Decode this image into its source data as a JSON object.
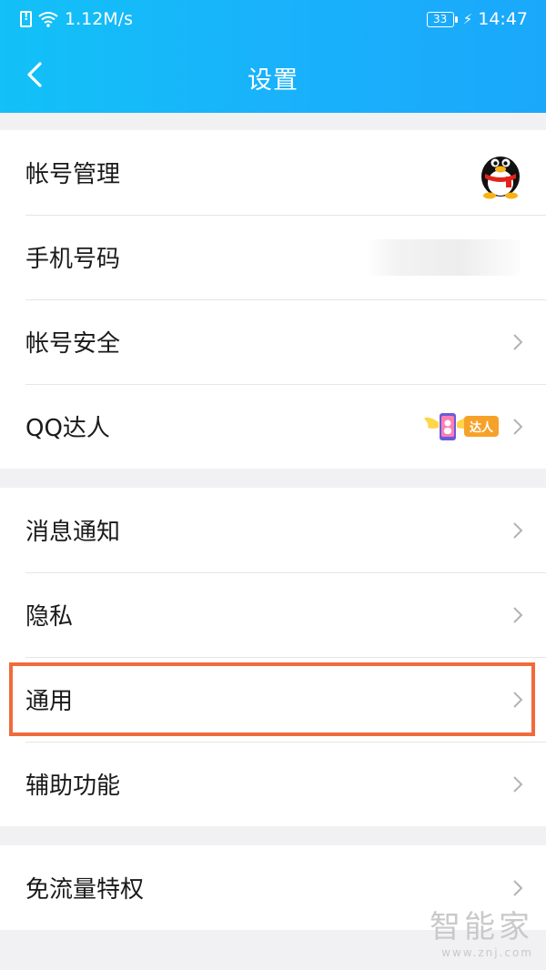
{
  "status_bar": {
    "network_speed": "1.12M/s",
    "battery_level": "33",
    "time": "14:47",
    "icons": [
      "sim-alert-icon",
      "wifi-icon",
      "battery-icon",
      "charging-bolt-icon"
    ]
  },
  "header": {
    "title": "设置",
    "back_icon": "back-arrow-icon"
  },
  "groups": [
    {
      "items": [
        {
          "label": "帐号管理",
          "accessory": "qq-penguin-avatar"
        },
        {
          "label": "手机号码",
          "accessory": "blurred-phone-number"
        },
        {
          "label": "帐号安全",
          "accessory": "chevron"
        },
        {
          "label": "QQ达人",
          "accessory": "badge+chevron",
          "badge_text": "达人"
        }
      ]
    },
    {
      "items": [
        {
          "label": "消息通知",
          "accessory": "chevron"
        },
        {
          "label": "隐私",
          "accessory": "chevron"
        },
        {
          "label": "通用",
          "accessory": "chevron",
          "highlighted": true
        },
        {
          "label": "辅助功能",
          "accessory": "chevron"
        }
      ]
    },
    {
      "items": [
        {
          "label": "免流量特权",
          "accessory": "chevron"
        }
      ]
    }
  ],
  "watermark": {
    "text": "智能家",
    "url": "www.znj.com"
  },
  "colors": {
    "header_gradient_start": "#12c1f7",
    "header_gradient_end": "#1aa8fb",
    "background": "#f1f1f3",
    "highlight_border": "#f06a3a",
    "badge": "#f6a22a"
  }
}
